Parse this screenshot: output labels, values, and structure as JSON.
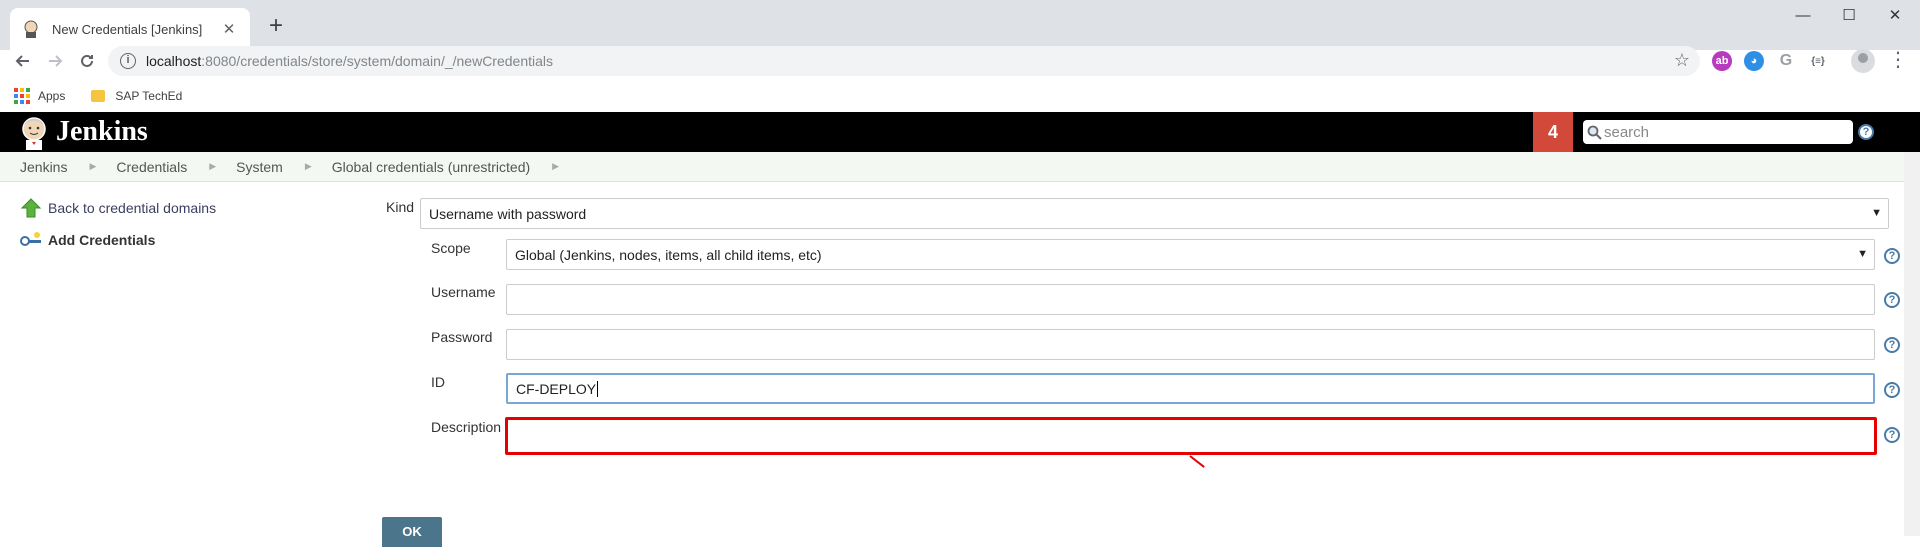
{
  "browser": {
    "tab_title": "New Credentials [Jenkins]",
    "tab_close": "✕",
    "new_tab": "+",
    "url_host": "localhost",
    "url_path": ":8080/credentials/store/system/domain/_/newCredentials",
    "window_controls": {
      "minimize": "—",
      "maximize": "☐",
      "close": "✕"
    },
    "extensions": [
      {
        "name": "ext-magenta-icon",
        "glyph": "ab",
        "color": "#b83bbf"
      },
      {
        "name": "ext-blue-icon",
        "glyph": "◕",
        "color": "#2f8fe5"
      },
      {
        "name": "google-icon",
        "glyph": "G"
      },
      {
        "name": "json-icon",
        "glyph": "{≡}"
      }
    ]
  },
  "bookmarks": {
    "apps_label": "Apps",
    "folder_label": "SAP TechEd",
    "apps_colors": [
      "#ea4335",
      "#fbbc05",
      "#34a853",
      "#4285f4",
      "#ea4335",
      "#fbbc05",
      "#34a853",
      "#4285f4",
      "#ea4335"
    ]
  },
  "header": {
    "title": "Jenkins",
    "badge_count": "4",
    "search_placeholder": "search",
    "help": "?"
  },
  "breadcrumb": [
    "Jenkins",
    "Credentials",
    "System",
    "Global credentials (unrestricted)"
  ],
  "sidebar": {
    "back_label": "Back to credential domains",
    "add_label": "Add Credentials"
  },
  "form": {
    "kind_label": "Kind",
    "kind_value": "Username with password",
    "scope_label": "Scope",
    "scope_value": "Global (Jenkins, nodes, items, all child items, etc)",
    "username_label": "Username",
    "username_value": "",
    "password_label": "Password",
    "password_value": "",
    "id_label": "ID",
    "id_value": "CF-DEPLOY",
    "description_label": "Description",
    "description_value": "",
    "ok_label": "OK",
    "help": "?",
    "dropdown_arrow": "▼"
  },
  "colors": {
    "header_bg": "#000000",
    "badge": "#d24939",
    "highlight": "#e60000",
    "ok_button": "#4b758b",
    "link": "#3a3e61"
  }
}
